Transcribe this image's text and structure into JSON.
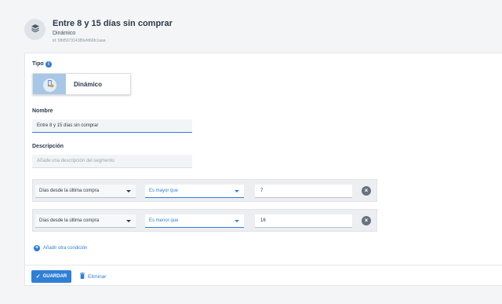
{
  "header": {
    "title": "Entre 8 y 15 días sin comprar",
    "subtitle": "Dinámico",
    "id_text": "id: 5fbf507314389efd66fc1aaa",
    "icon": "layers-icon"
  },
  "form": {
    "type_label": "Tipo",
    "type_option": "Dinámico",
    "type_icon": "phone-sync-icon",
    "name_label": "Nombre",
    "name_value": "Entre 8 y 15 días sin comprar",
    "description_label": "Descripción",
    "description_placeholder": "Añade una descripción del segmento",
    "conditions": [
      {
        "field": "Días desde la última compra",
        "operator": "Es mayor que",
        "value": "7"
      },
      {
        "field": "Días desde la última compra",
        "operator": "Es menor que",
        "value": "16"
      }
    ],
    "add_condition_label": "Añadir otra condición"
  },
  "actions": {
    "save_label": "GUARDAR",
    "delete_label": "Eliminar"
  },
  "colors": {
    "accent": "#2f7fd6",
    "background": "#f4f5f7"
  }
}
